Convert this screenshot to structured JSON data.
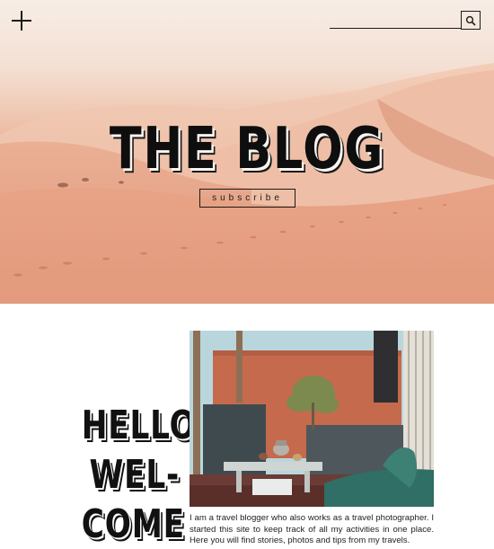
{
  "header": {
    "menu_icon": "plus-icon",
    "search_icon": "search-icon",
    "search_value": ""
  },
  "hero": {
    "title": "THE BLOG",
    "subscribe_label": "subscribe"
  },
  "welcome": {
    "lines": [
      "HELLO!",
      "WEL-",
      "COME"
    ],
    "intro_text": "I am a travel blogger who also works as a travel photographer. I started this site to keep track of all my activities in one place. Here you will find stories, photos and tips from my travels."
  },
  "colors": {
    "sky": "#f7ede6",
    "sand": "#e59a7c",
    "ink": "#111111"
  }
}
